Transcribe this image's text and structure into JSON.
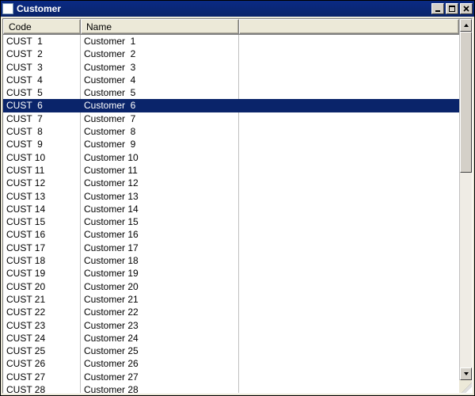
{
  "window": {
    "title": "Customer"
  },
  "grid": {
    "columns": {
      "code": "Code",
      "name": "Name"
    },
    "selected_index": 5,
    "rows": [
      {
        "code": "CUST  1",
        "name": "Customer  1"
      },
      {
        "code": "CUST  2",
        "name": "Customer  2"
      },
      {
        "code": "CUST  3",
        "name": "Customer  3"
      },
      {
        "code": "CUST  4",
        "name": "Customer  4"
      },
      {
        "code": "CUST  5",
        "name": "Customer  5"
      },
      {
        "code": "CUST  6",
        "name": "Customer  6"
      },
      {
        "code": "CUST  7",
        "name": "Customer  7"
      },
      {
        "code": "CUST  8",
        "name": "Customer  8"
      },
      {
        "code": "CUST  9",
        "name": "Customer  9"
      },
      {
        "code": "CUST 10",
        "name": "Customer 10"
      },
      {
        "code": "CUST 11",
        "name": "Customer 11"
      },
      {
        "code": "CUST 12",
        "name": "Customer 12"
      },
      {
        "code": "CUST 13",
        "name": "Customer 13"
      },
      {
        "code": "CUST 14",
        "name": "Customer 14"
      },
      {
        "code": "CUST 15",
        "name": "Customer 15"
      },
      {
        "code": "CUST 16",
        "name": "Customer 16"
      },
      {
        "code": "CUST 17",
        "name": "Customer 17"
      },
      {
        "code": "CUST 18",
        "name": "Customer 18"
      },
      {
        "code": "CUST 19",
        "name": "Customer 19"
      },
      {
        "code": "CUST 20",
        "name": "Customer 20"
      },
      {
        "code": "CUST 21",
        "name": "Customer 21"
      },
      {
        "code": "CUST 22",
        "name": "Customer 22"
      },
      {
        "code": "CUST 23",
        "name": "Customer 23"
      },
      {
        "code": "CUST 24",
        "name": "Customer 24"
      },
      {
        "code": "CUST 25",
        "name": "Customer 25"
      },
      {
        "code": "CUST 26",
        "name": "Customer 26"
      },
      {
        "code": "CUST 27",
        "name": "Customer 27"
      },
      {
        "code": "CUST 28",
        "name": "Customer 28"
      }
    ]
  }
}
